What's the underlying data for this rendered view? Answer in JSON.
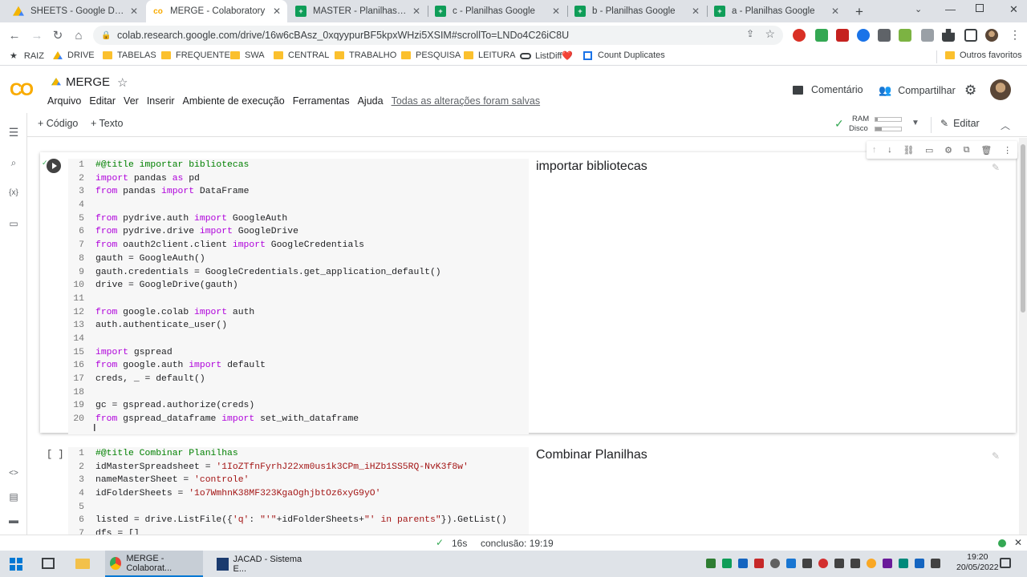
{
  "browser": {
    "tabs": [
      {
        "label": "SHEETS - Google Drive",
        "icon": "google-drive-icon",
        "color": "#1a73e8"
      },
      {
        "label": "MERGE - Colaboratory",
        "icon": "colab-icon",
        "color": "#f9ab00",
        "active": true
      },
      {
        "label": "MASTER - Planilhas Google",
        "icon": "sheets-icon",
        "color": "#0f9d58"
      },
      {
        "label": "c - Planilhas Google",
        "icon": "sheets-icon",
        "color": "#0f9d58"
      },
      {
        "label": "b - Planilhas Google",
        "icon": "sheets-icon",
        "color": "#0f9d58"
      },
      {
        "label": "a - Planilhas Google",
        "icon": "sheets-icon",
        "color": "#0f9d58"
      }
    ],
    "url": "colab.research.google.com/drive/16w6cBAsz_0xqyypurBF5kpxWHzi5XSIM#scrollTo=LNDo4C26iC8U",
    "bookmarks": [
      "RAIZ",
      "DRIVE",
      "TABELAS",
      "FREQUENTE",
      "SWA",
      "CENTRAL",
      "TRABALHO",
      "PESQUISA",
      "LEITURA",
      "ListDiff❤️",
      "Count Duplicates"
    ],
    "other_bookmarks": "Outros favoritos"
  },
  "colab": {
    "logo": "CO",
    "notebook_title": "MERGE",
    "menu": [
      "Arquivo",
      "Editar",
      "Ver",
      "Inserir",
      "Ambiente de execução",
      "Ferramentas",
      "Ajuda"
    ],
    "saved_status": "Todas as alterações foram salvas",
    "comment_label": "Comentário",
    "share_label": "Compartilhar",
    "add_code": "+ Código",
    "add_text": "+ Texto",
    "ram_label": "RAM",
    "disk_label": "Disco",
    "ram_fraction": 0.1,
    "disk_fraction": 0.25,
    "edit_label": "Editar"
  },
  "cells": [
    {
      "title": "importar bibliotecas",
      "lines": [
        "#@title importar bibliotecas",
        "import pandas as pd",
        "from pandas import DataFrame",
        "",
        "from pydrive.auth import GoogleAuth",
        "from pydrive.drive import GoogleDrive",
        "from oauth2client.client import GoogleCredentials",
        "gauth = GoogleAuth()",
        "gauth.credentials = GoogleCredentials.get_application_default()",
        "drive = GoogleDrive(gauth)",
        "",
        "from google.colab import auth",
        "auth.authenticate_user()",
        "",
        "import gspread",
        "from google.auth import default",
        "creds, _ = default()",
        "",
        "gc = gspread.authorize(creds)",
        "from gspread_dataframe import set_with_dataframe"
      ]
    },
    {
      "title": "Combinar Planilhas",
      "exec": "[ ]",
      "lines": [
        "#@title Combinar Planilhas",
        "idMasterSpreadsheet = '1IoZTfnFyrhJ22xm0us1k3CPm_iHZb1SS5RQ-NvK3f8w'",
        "nameMasterSheet = 'controle'",
        "idFolderSheets = '1o7WmhnK38MF323KgaOghjbtOz6xyG9yO'",
        "",
        "listed = drive.ListFile({'q': \"'\"+idFolderSheets+\"' in parents\"}).GetList()",
        "dfs = []"
      ]
    }
  ],
  "status": {
    "duration": "16s",
    "completion": "conclusão: 19:19"
  },
  "taskbar": {
    "apps": [
      "MERGE - Colaborat...",
      "JACAD - Sistema E..."
    ],
    "time": "19:20",
    "date": "20/05/2022"
  }
}
